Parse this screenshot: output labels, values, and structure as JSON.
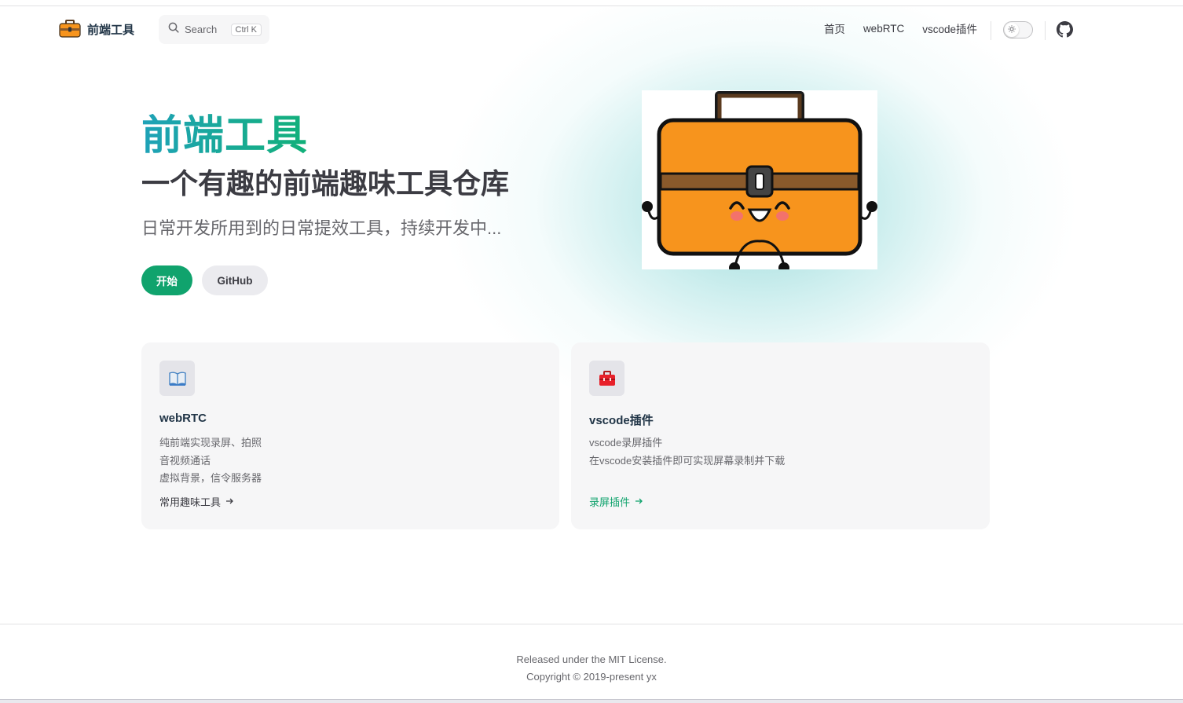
{
  "nav": {
    "site_title": "前端工具",
    "search_placeholder": "Search",
    "search_shortcut": "Ctrl K",
    "links": [
      {
        "label": "首页"
      },
      {
        "label": "webRTC"
      },
      {
        "label": "vscode插件"
      }
    ],
    "theme_toggle_icon": "sun-icon",
    "github_icon": "github-icon"
  },
  "hero": {
    "name": "前端工具",
    "text": "一个有趣的前端趣味工具仓库",
    "tagline": "日常开发所用到的日常提效工具，持续开发中...",
    "actions": [
      {
        "label": "开始",
        "theme": "brand"
      },
      {
        "label": "GitHub",
        "theme": "alt"
      }
    ],
    "image": "toolbox-mascot"
  },
  "features": [
    {
      "icon": "📖",
      "title": "webRTC",
      "details": [
        "纯前端实现录屏、拍照",
        "音视频通话",
        "虚拟背景，信令服务器"
      ],
      "link_text": "常用趣味工具"
    },
    {
      "icon": "🧰",
      "title": "vscode插件",
      "details": [
        "vscode录屏插件",
        "在vscode安装插件即可实现屏幕录制并下载"
      ],
      "link_text": "录屏插件"
    }
  ],
  "footer": {
    "message": "Released under the MIT License.",
    "copyright": "Copyright © 2019-present yx"
  },
  "colors": {
    "brand": "#10a36d",
    "name_gradient_start": "#1fa2b8",
    "name_gradient_end": "#12b079",
    "toolbox_orange": "#f7941d",
    "toolbox_band": "#8a5a2b"
  }
}
